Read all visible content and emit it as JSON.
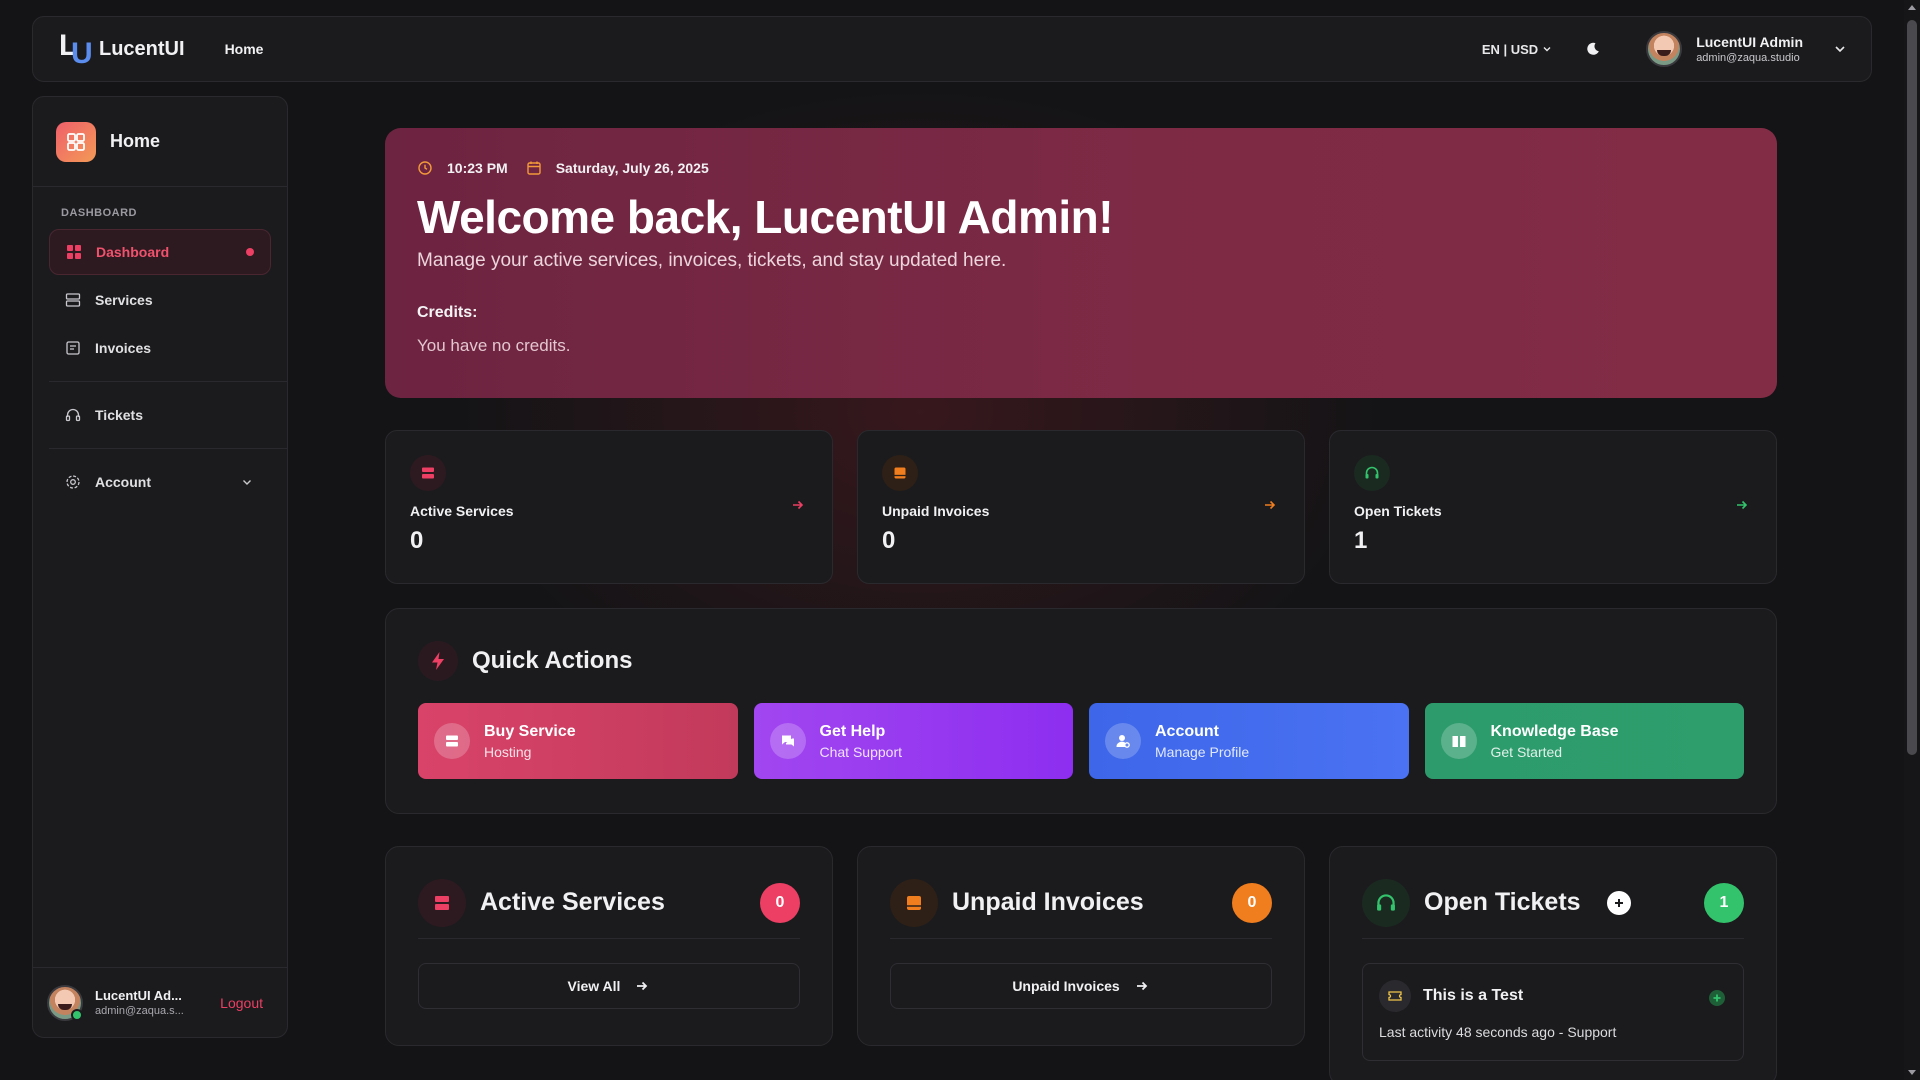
{
  "brand": {
    "name": "LucentUI",
    "mark_l": "L",
    "mark_u": "U"
  },
  "topnav": {
    "home_link": "Home",
    "locale": "EN | USD"
  },
  "user": {
    "name": "LucentUI Admin",
    "email": "admin@zaqua.studio",
    "name_short": "LucentUI Ad...",
    "email_short": "admin@zaqua.s..."
  },
  "sidebar": {
    "header_title": "Home",
    "section_label": "DASHBOARD",
    "items": [
      {
        "label": "Dashboard"
      },
      {
        "label": "Services"
      },
      {
        "label": "Invoices"
      },
      {
        "label": "Tickets"
      },
      {
        "label": "Account"
      }
    ],
    "logout_label": "Logout"
  },
  "hero": {
    "time": "10:23 PM",
    "date": "Saturday, July 26, 2025",
    "title": "Welcome back, LucentUI Admin!",
    "subtitle": "Manage your active services, invoices, tickets, and stay updated here.",
    "credits_label": "Credits:",
    "credits_text": "You have no credits."
  },
  "stats": [
    {
      "label": "Active Services",
      "value": "0",
      "color": "#ec3f63"
    },
    {
      "label": "Unpaid Invoices",
      "value": "0",
      "color": "#f07d1e"
    },
    {
      "label": "Open Tickets",
      "value": "1",
      "color": "#33c36c"
    }
  ],
  "quick_actions": {
    "title": "Quick Actions",
    "buttons": [
      {
        "title": "Buy Service",
        "subtitle": "Hosting"
      },
      {
        "title": "Get Help",
        "subtitle": "Chat Support"
      },
      {
        "title": "Account",
        "subtitle": "Manage Profile"
      },
      {
        "title": "Knowledge Base",
        "subtitle": "Get Started"
      }
    ]
  },
  "panels": {
    "services": {
      "title": "Active Services",
      "count": "0",
      "button": "View All"
    },
    "invoices": {
      "title": "Unpaid Invoices",
      "count": "0",
      "button": "Unpaid Invoices"
    },
    "tickets": {
      "title": "Open Tickets",
      "count": "1",
      "ticket": {
        "title": "This is a Test",
        "meta": "Last activity 48 seconds ago - Support"
      }
    }
  },
  "colors": {
    "accent": "#ec3f63",
    "orange": "#f07d1e",
    "green": "#33c36c",
    "hero": "#7d2a45"
  }
}
